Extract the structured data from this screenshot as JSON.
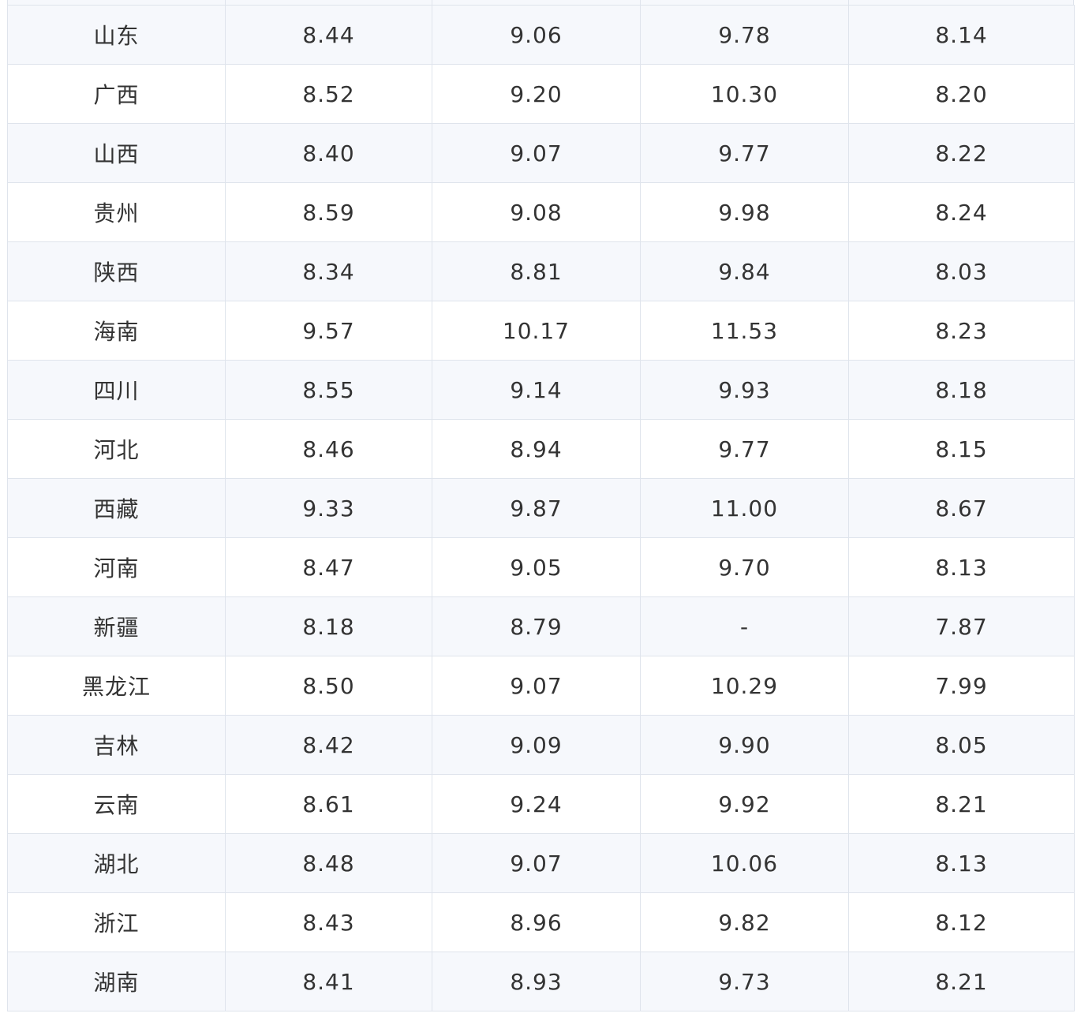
{
  "table": {
    "rows": [
      [
        "山东",
        "8.44",
        "9.06",
        "9.78",
        "8.14"
      ],
      [
        "广西",
        "8.52",
        "9.20",
        "10.30",
        "8.20"
      ],
      [
        "山西",
        "8.40",
        "9.07",
        "9.77",
        "8.22"
      ],
      [
        "贵州",
        "8.59",
        "9.08",
        "9.98",
        "8.24"
      ],
      [
        "陕西",
        "8.34",
        "8.81",
        "9.84",
        "8.03"
      ],
      [
        "海南",
        "9.57",
        "10.17",
        "11.53",
        "8.23"
      ],
      [
        "四川",
        "8.55",
        "9.14",
        "9.93",
        "8.18"
      ],
      [
        "河北",
        "8.46",
        "8.94",
        "9.77",
        "8.15"
      ],
      [
        "西藏",
        "9.33",
        "9.87",
        "11.00",
        "8.67"
      ],
      [
        "河南",
        "8.47",
        "9.05",
        "9.70",
        "8.13"
      ],
      [
        "新疆",
        "8.18",
        "8.79",
        "-",
        "7.87"
      ],
      [
        "黑龙江",
        "8.50",
        "9.07",
        "10.29",
        "7.99"
      ],
      [
        "吉林",
        "8.42",
        "9.09",
        "9.90",
        "8.05"
      ],
      [
        "云南",
        "8.61",
        "9.24",
        "9.92",
        "8.21"
      ],
      [
        "湖北",
        "8.48",
        "9.07",
        "10.06",
        "8.13"
      ],
      [
        "浙江",
        "8.43",
        "8.96",
        "9.82",
        "8.12"
      ],
      [
        "湖南",
        "8.41",
        "8.93",
        "9.73",
        "8.21"
      ]
    ]
  },
  "colors": {
    "row_stripe": "#f6f8fc",
    "row_plain": "#ffffff",
    "border": "#dfe4ec",
    "text": "#333333"
  }
}
